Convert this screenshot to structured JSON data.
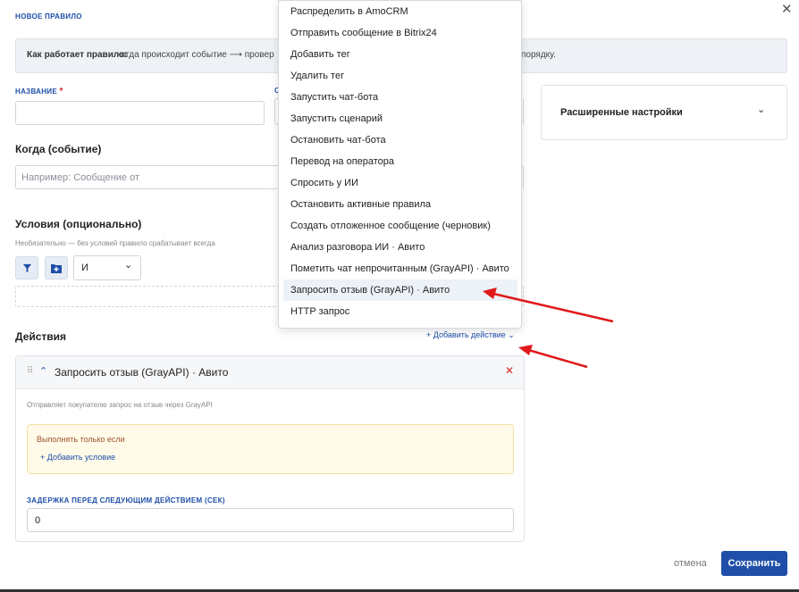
{
  "modal": {
    "title": "НОВОЕ ПРАВИЛО",
    "close_icon": "✕",
    "info_label": "Как работает правило:",
    "info_text": "когда происходит событие ⟶ провер",
    "info_tail": "порядку."
  },
  "fields": {
    "name_label": "НАЗВАНИЕ",
    "name_required": "*",
    "name_value": "",
    "second_label_fragment": "С"
  },
  "when": {
    "title": "Когда (событие)",
    "placeholder": "Например: Сообщение от"
  },
  "conditions": {
    "title": "Условия (опционально)",
    "hint": "Необязательно — без условий правило срабатывает всегда",
    "logic_value": "И",
    "logic_chevron": "⌄"
  },
  "advanced": {
    "label": "Расширенные настройки",
    "chevron": "⌄"
  },
  "actions": {
    "title": "Действия",
    "add_label": "+ Добавить действие",
    "add_chevron": "⌄",
    "card": {
      "grip": "⠿",
      "chevron": "⌃",
      "title": "Запросить отзыв (GrayAPI) · Авито",
      "delete": "✕",
      "description": "Отправляет покупателю запрос на отзыв через GrayAPI",
      "condition_title": "Выполнять только если",
      "condition_add": "+ Добавить условие",
      "delay_label": "ЗАДЕРЖКА ПЕРЕД СЛЕДУЮЩИМ ДЕЙСТВИЕМ (СЕК)",
      "delay_value": "0"
    }
  },
  "dropdown": {
    "items": [
      "Распределить в AmoCRM",
      "Отправить сообщение в Bitrix24",
      "Добавить тег",
      "Удалить тег",
      "Запустить чат-бота",
      "Запустить сценарий",
      "Остановить чат-бота",
      "Перевод на оператора",
      "Спросить у ИИ",
      "Остановить активные правила",
      "Создать отложенное сообщение (черновик)",
      "Анализ разговора ИИ · Авито",
      "Пометить чат непрочитанным (GrayAPI) · Авито",
      "Запросить отзыв (GrayAPI) · Авито",
      "HTTP запрос"
    ],
    "highlighted_index": 13
  },
  "footer": {
    "cancel": "отмена",
    "save": "Сохранить"
  },
  "colors": {
    "accent": "#1f4fa8",
    "danger": "#d62828",
    "annotation_arrow": "#e0191b"
  }
}
